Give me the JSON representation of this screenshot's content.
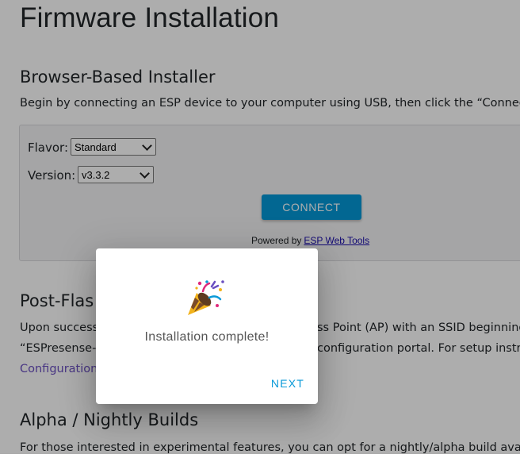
{
  "page": {
    "title": "Firmware Installation",
    "installer": {
      "heading": "Browser-Based Installer",
      "intro": "Begin by connecting an ESP device to your computer using USB, then click the “Connect”",
      "flavor_label": "Flavor:",
      "flavor_value": "Standard",
      "version_label": "Version:",
      "version_value": "v3.3.2",
      "connect_label": "CONNECT",
      "powered_by": "Powered by",
      "powered_link": "ESP Web Tools"
    },
    "post_flash": {
      "heading": "Post-Flas",
      "line1_a": "Upon success",
      "line1_b": "ss Point (AP) with an SSID beginning",
      "line2_a": "“ESPresense-”",
      "line2_b": "configuration portal. For setup instru",
      "line3_link": "Configuration"
    },
    "alpha": {
      "heading": "Alpha / Nightly Builds",
      "intro": "For those interested in experimental features, you can opt for a nightly/alpha build availab"
    }
  },
  "dialog": {
    "icon": "party-popper-icon",
    "message": "Installation complete!",
    "next_label": "NEXT"
  },
  "colors": {
    "accent": "#0399d8",
    "link": "#6a4fc1",
    "next": "#0a9ad8"
  }
}
